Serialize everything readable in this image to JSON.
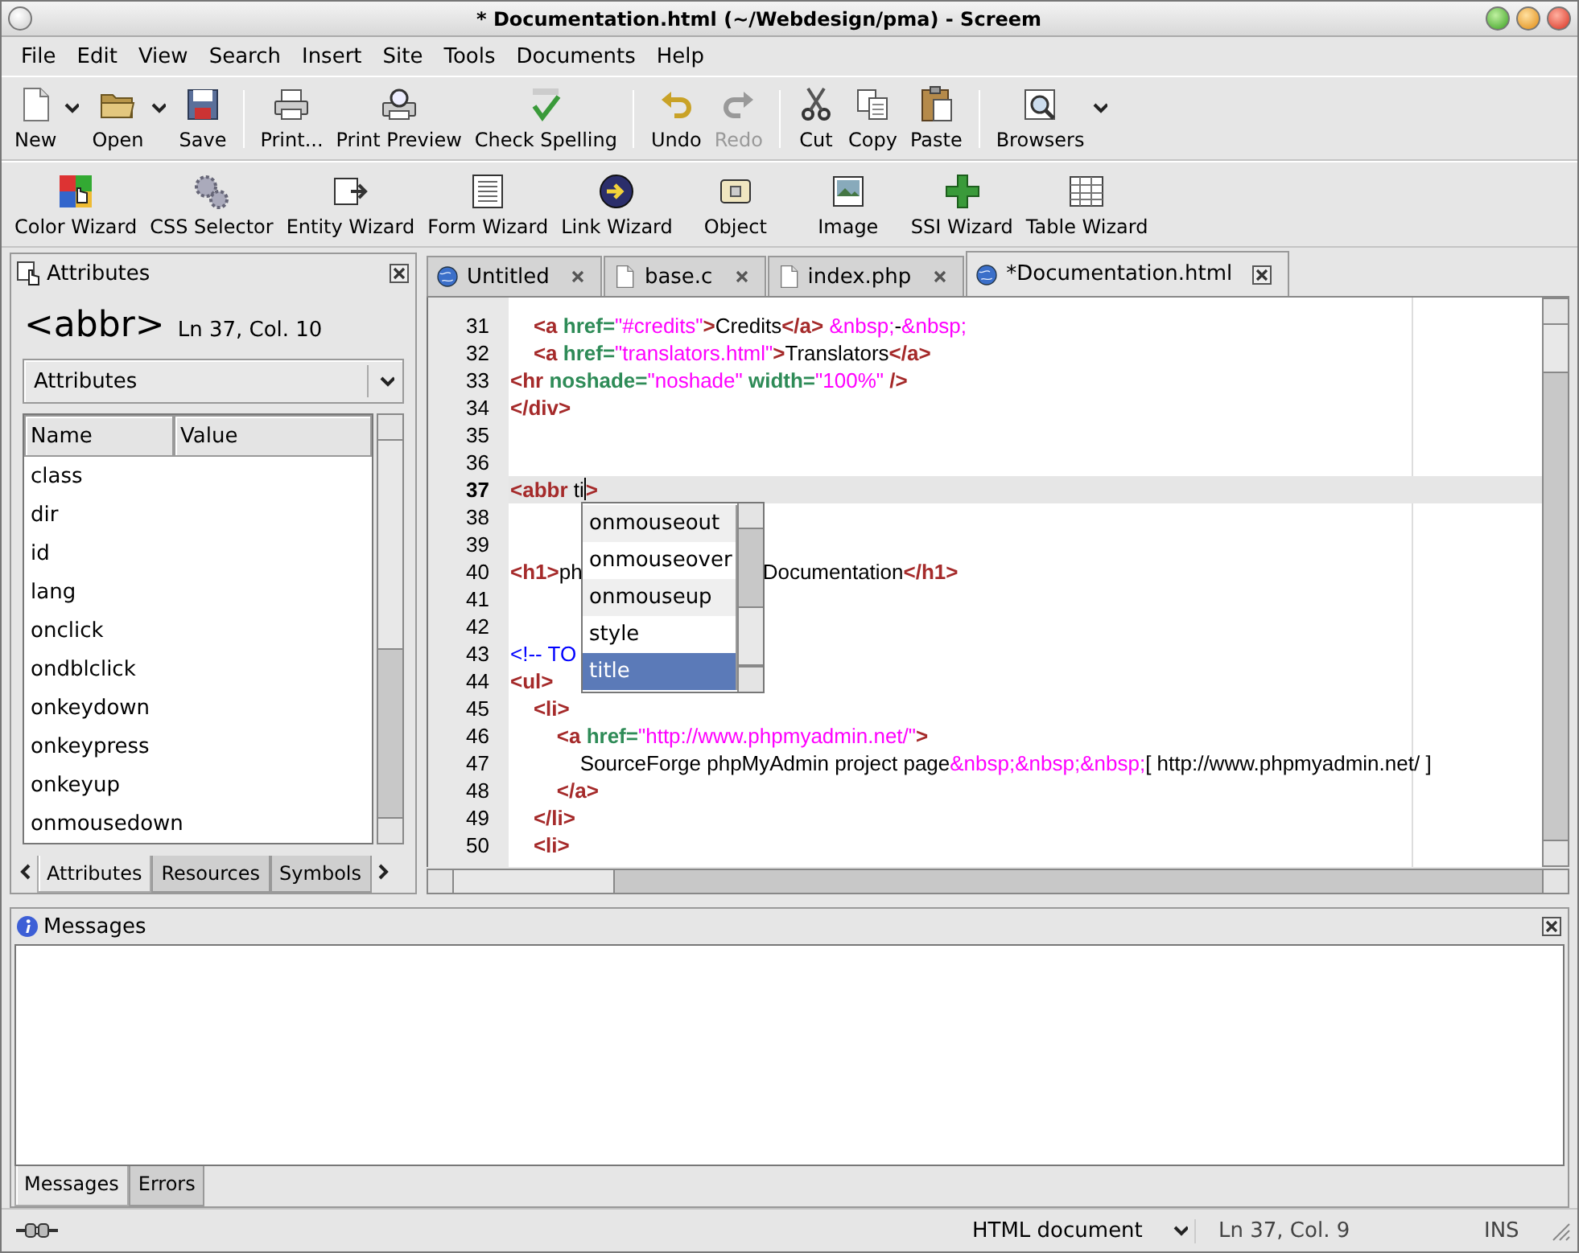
{
  "window": {
    "title": "* Documentation.html (~/Webdesign/pma) - Screem"
  },
  "menu": [
    "File",
    "Edit",
    "View",
    "Search",
    "Insert",
    "Site",
    "Tools",
    "Documents",
    "Help"
  ],
  "toolbar": [
    {
      "kind": "button",
      "label": "New",
      "disabled": false,
      "has_menu": true
    },
    {
      "kind": "button",
      "label": "Open",
      "disabled": false,
      "has_menu": true
    },
    {
      "kind": "button",
      "label": "Save",
      "disabled": false,
      "has_menu": false
    },
    {
      "kind": "separator"
    },
    {
      "kind": "button",
      "label": "Print...",
      "disabled": false,
      "has_menu": false
    },
    {
      "kind": "button",
      "label": "Print Preview",
      "disabled": false,
      "has_menu": false
    },
    {
      "kind": "button",
      "label": "Check Spelling",
      "disabled": false,
      "has_menu": false
    },
    {
      "kind": "separator"
    },
    {
      "kind": "button",
      "label": "Undo",
      "disabled": false,
      "has_menu": false
    },
    {
      "kind": "button",
      "label": "Redo",
      "disabled": true,
      "has_menu": false
    },
    {
      "kind": "separator"
    },
    {
      "kind": "button",
      "label": "Cut",
      "disabled": false,
      "has_menu": false
    },
    {
      "kind": "button",
      "label": "Copy",
      "disabled": false,
      "has_menu": false
    },
    {
      "kind": "button",
      "label": "Paste",
      "disabled": false,
      "has_menu": false
    },
    {
      "kind": "separator"
    },
    {
      "kind": "button",
      "label": "Browsers",
      "disabled": false,
      "has_menu": true
    }
  ],
  "wizard_bar": [
    "Color Wizard",
    "CSS Selector",
    "Entity Wizard",
    "Form Wizard",
    "Link Wizard",
    "Object",
    "Image",
    "SSI Wizard",
    "Table Wizard"
  ],
  "sidebar": {
    "title": "Attributes",
    "element": "<abbr>",
    "position": "Ln 37, Col. 10",
    "selector": "Attributes",
    "columns": [
      "Name",
      "Value"
    ],
    "rows": [
      "class",
      "dir",
      "id",
      "lang",
      "onclick",
      "ondblclick",
      "onkeydown",
      "onkeypress",
      "onkeyup",
      "onmousedown"
    ],
    "tabs": [
      {
        "label": "Attributes",
        "selected": true
      },
      {
        "label": "Resources",
        "selected": false
      },
      {
        "label": "Symbols",
        "selected": false
      }
    ]
  },
  "editor": {
    "tabs": [
      {
        "label": "Untitled",
        "selected": false
      },
      {
        "label": "base.c",
        "selected": false
      },
      {
        "label": "index.php",
        "selected": false
      },
      {
        "label": "*Documentation.html",
        "selected": true
      }
    ],
    "lines": [
      {
        "number": "31",
        "current": false,
        "tokens": [
          {
            "kind": "tag",
            "text": "    <a"
          },
          {
            "kind": "attr",
            "text": " href="
          },
          {
            "kind": "value",
            "text": "\"#credits\""
          },
          {
            "kind": "tag",
            "text": ">"
          },
          {
            "kind": "text",
            "text": "Credits"
          },
          {
            "kind": "tag",
            "text": "</a>"
          },
          {
            "kind": "entity",
            "text": " &nbsp;"
          },
          {
            "kind": "text",
            "text": "-"
          },
          {
            "kind": "entity",
            "text": "&nbsp;"
          }
        ]
      },
      {
        "number": "32",
        "current": false,
        "tokens": [
          {
            "kind": "tag",
            "text": "    <a"
          },
          {
            "kind": "attr",
            "text": " href="
          },
          {
            "kind": "value",
            "text": "\"translators.html\""
          },
          {
            "kind": "tag",
            "text": ">"
          },
          {
            "kind": "text",
            "text": "Translators"
          },
          {
            "kind": "tag",
            "text": "</a>"
          }
        ]
      },
      {
        "number": "33",
        "current": false,
        "tokens": [
          {
            "kind": "tag",
            "text": "<hr"
          },
          {
            "kind": "attr",
            "text": " noshade="
          },
          {
            "kind": "value",
            "text": "\"noshade\""
          },
          {
            "kind": "attr",
            "text": " width="
          },
          {
            "kind": "value",
            "text": "\"100%\""
          },
          {
            "kind": "tag",
            "text": " />"
          }
        ]
      },
      {
        "number": "34",
        "current": false,
        "tokens": [
          {
            "kind": "tag",
            "text": "</div>"
          }
        ]
      },
      {
        "number": "35",
        "current": false
      },
      {
        "number": "36",
        "current": false
      },
      {
        "number": "37",
        "current": true,
        "tokens": [
          {
            "kind": "tag",
            "text": "<abbr"
          },
          {
            "kind": "text",
            "text": " ti"
          },
          {
            "kind": "cursor"
          },
          {
            "kind": "tag",
            "text": ">"
          }
        ]
      },
      {
        "number": "38",
        "current": false
      },
      {
        "number": "39",
        "current": false
      },
      {
        "number": "40",
        "current": false,
        "tokens": [
          {
            "kind": "tag",
            "text": "<h1>"
          },
          {
            "kind": "text",
            "text": "ph"
          },
          {
            "kind": "gap"
          },
          {
            "kind": "text",
            "text": "Documentation"
          },
          {
            "kind": "tag",
            "text": "</h1>"
          }
        ]
      },
      {
        "number": "41",
        "current": false
      },
      {
        "number": "42",
        "current": false
      },
      {
        "number": "43",
        "current": false,
        "tokens": [
          {
            "kind": "comment",
            "text": "<!-- TO"
          }
        ]
      },
      {
        "number": "44",
        "current": false,
        "tokens": [
          {
            "kind": "tag",
            "text": "<ul>"
          }
        ]
      },
      {
        "number": "45",
        "current": false,
        "tokens": [
          {
            "kind": "tag",
            "text": "    <li>"
          }
        ]
      },
      {
        "number": "46",
        "current": false,
        "tokens": [
          {
            "kind": "tag",
            "text": "        <a"
          },
          {
            "kind": "attr",
            "text": " href="
          },
          {
            "kind": "value",
            "text": "\"http://www.phpmyadmin.net/\""
          },
          {
            "kind": "tag",
            "text": ">"
          }
        ]
      },
      {
        "number": "47",
        "current": false,
        "tokens": [
          {
            "kind": "text",
            "text": "            SourceForge phpMyAdmin project page"
          },
          {
            "kind": "entity",
            "text": "&nbsp;&nbsp;&nbsp;"
          },
          {
            "kind": "text",
            "text": "[ http://www.phpmyadmin.net/ ]"
          }
        ]
      },
      {
        "number": "48",
        "current": false,
        "tokens": [
          {
            "kind": "tag",
            "text": "        </a>"
          }
        ]
      },
      {
        "number": "49",
        "current": false,
        "tokens": [
          {
            "kind": "tag",
            "text": "    </li>"
          }
        ]
      },
      {
        "number": "50",
        "current": false,
        "tokens": [
          {
            "kind": "tag",
            "text": "    <li>"
          }
        ]
      }
    ],
    "completion": [
      {
        "label": "onmouseout",
        "selected": false
      },
      {
        "label": "onmouseover",
        "selected": false
      },
      {
        "label": "onmouseup",
        "selected": false
      },
      {
        "label": "style",
        "selected": false
      },
      {
        "label": "title",
        "selected": true
      }
    ]
  },
  "messages": {
    "title": "Messages",
    "tabs": [
      {
        "label": "Messages",
        "selected": true
      },
      {
        "label": "Errors",
        "selected": false
      }
    ]
  },
  "status_bar": {
    "document_type": "HTML document",
    "position": "Ln 37, Col. 9",
    "mode": "INS"
  }
}
